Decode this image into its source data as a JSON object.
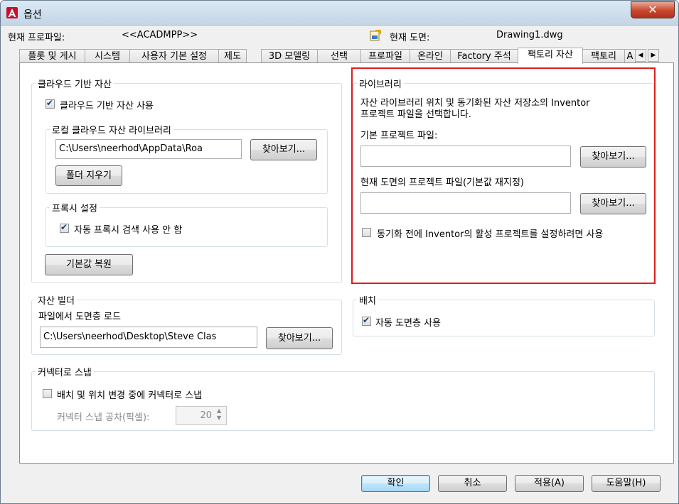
{
  "window": {
    "title": "옵션",
    "close_label": "✕"
  },
  "header": {
    "current_profile_label": "현재 프로파일:",
    "current_profile_value": "<<ACADMPP>>",
    "current_drawing_label": "현재 도면:",
    "current_drawing_value": "Drawing1.dwg"
  },
  "tabs": [
    {
      "label": "플롯 및 게시"
    },
    {
      "label": "시스템"
    },
    {
      "label": "사용자 기본 설정"
    },
    {
      "label": "제도"
    },
    {
      "label": "3D 모델링"
    },
    {
      "label": "선택"
    },
    {
      "label": "프로파일"
    },
    {
      "label": "온라인"
    },
    {
      "label": "Factory 주석"
    },
    {
      "label": "팩토리 자산"
    },
    {
      "label": "팩토리"
    },
    {
      "label": "A"
    }
  ],
  "active_tab_index": 9,
  "cloud_assets": {
    "legend": "클라우드 기반 자산",
    "use_cloud_label": "클라우드 기반 자산 사용",
    "use_cloud_checked": true,
    "local_library": {
      "legend": "로컬 클라우드 자산 라이브러리",
      "path_value": "C:\\Users\\neerhod\\AppData\\Roa",
      "browse_label": "찾아보기...",
      "clear_folder_label": "폴더 지우기"
    },
    "proxy": {
      "legend": "프록시 설정",
      "auto_proxy_label": "자동 프록시 검색 사용 안 함",
      "auto_proxy_checked": true
    },
    "restore_defaults_label": "기본값 복원"
  },
  "library": {
    "legend": "라이브러리",
    "description_line1": "자산 라이브러리 위치 및 동기화된 자산 저장소의 Inventor",
    "description_line2": "프로젝트 파일을 선택합니다.",
    "default_project_label": "기본 프로젝트 파일:",
    "default_project_value": "",
    "browse1_label": "찾아보기...",
    "current_project_label": "현재 도면의 프로젝트 파일(기본값 재지정)",
    "current_project_value": "",
    "browse2_label": "찾아보기...",
    "sync_label": "동기화 전에 Inventor의 활성 프로젝트를 설정하려면 사용",
    "sync_checked": false
  },
  "asset_builder": {
    "legend": "자산 빌더",
    "load_layers_label": "파일에서 도면층 로드",
    "path_value": "C:\\Users\\neerhod\\Desktop\\Steve Clas",
    "browse_label": "찾아보기..."
  },
  "placement": {
    "legend": "배치",
    "auto_layer_label": "자동 도면층 사용",
    "auto_layer_checked": true
  },
  "connector_snap": {
    "legend": "커넥터로 스냅",
    "snap_label": "배치 및 위치 변경 중에 커넥터로 스냅",
    "snap_checked": false,
    "tolerance_label": "커넥터 스냅 공차(픽셀):",
    "tolerance_value": "20"
  },
  "footer": {
    "ok_label": "확인",
    "cancel_label": "취소",
    "apply_label": "적용(A)",
    "help_label": "도움말(H)"
  },
  "colors": {
    "highlight_border": "#e01e1e",
    "close_button": "#c9462c"
  }
}
